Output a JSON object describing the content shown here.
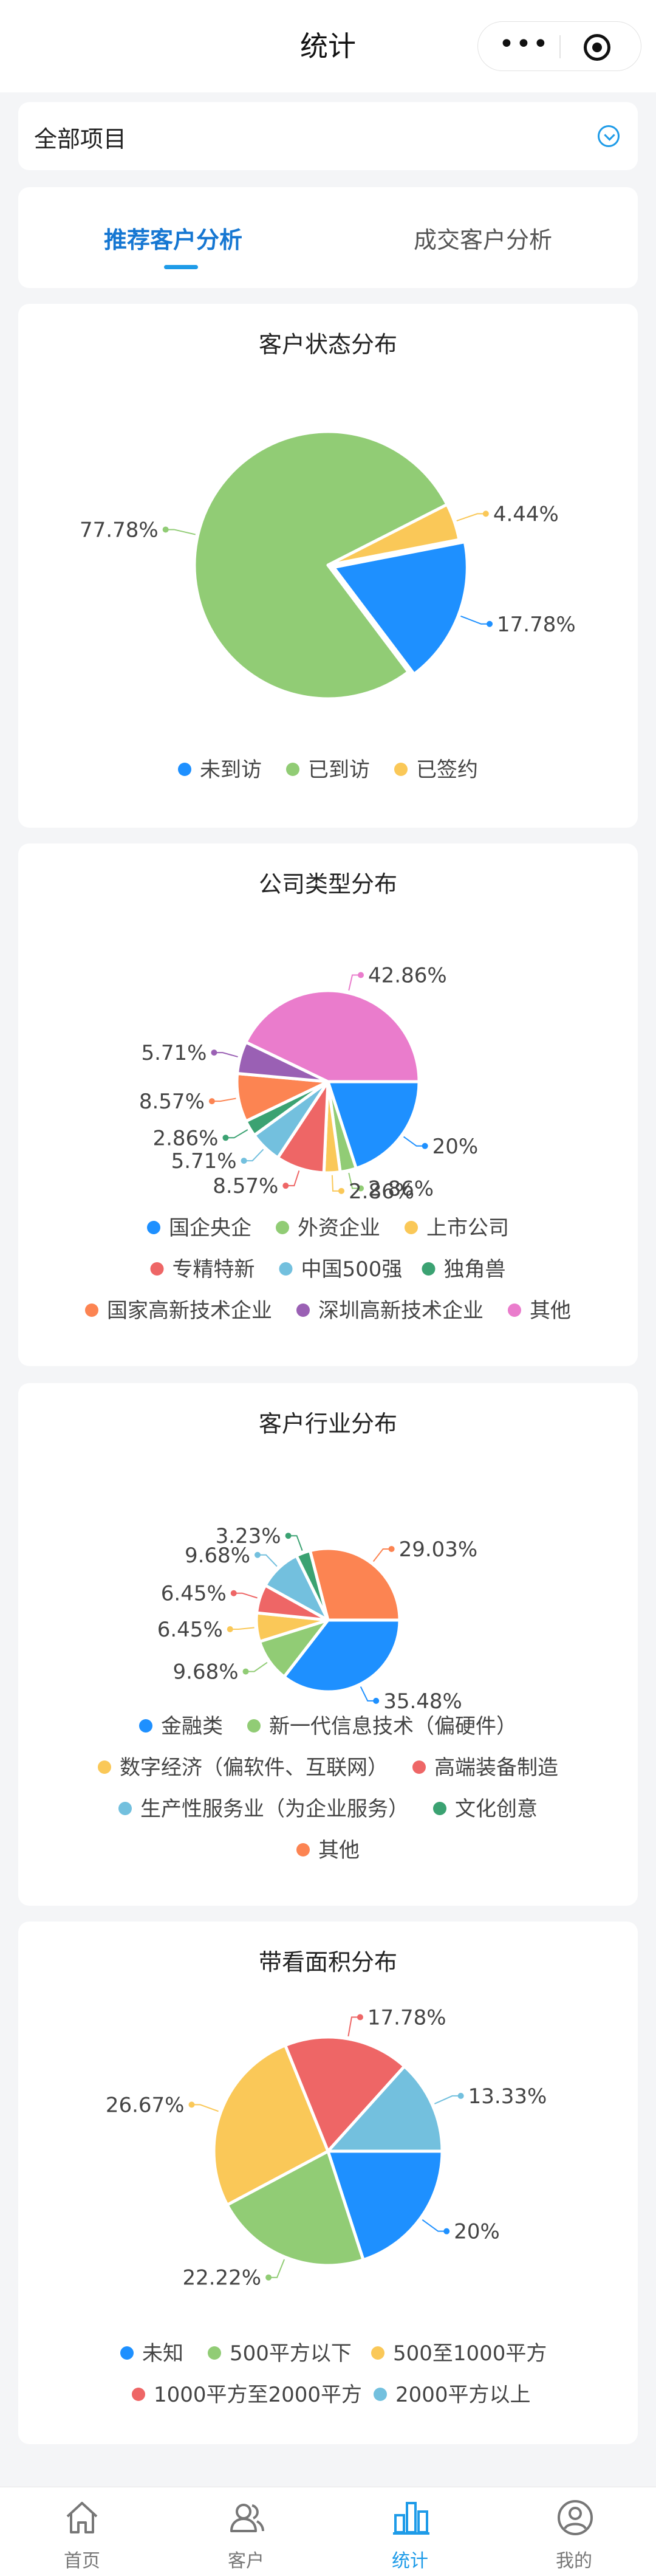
{
  "nav": {
    "title": "统计",
    "more_icon": "more-dots-icon",
    "close_icon": "target-icon"
  },
  "project_select": {
    "value": "全部项目",
    "icon": "chevron-down-circle-icon",
    "accent": "#1e9be8"
  },
  "tabs": [
    {
      "label": "推荐客户分析",
      "active": true
    },
    {
      "label": "成交客户分析",
      "active": false
    }
  ],
  "charts": [
    {
      "title": "客户状态分布",
      "chart_data": {
        "type": "pie",
        "slices": [
          {
            "name": "未到访",
            "value": 17.78,
            "label": "17.78%",
            "color": "#1e90ff"
          },
          {
            "name": "已到访",
            "value": 77.78,
            "label": "77.78%",
            "color": "#91cc75"
          },
          {
            "name": "已签约",
            "value": 4.44,
            "label": "4.44%",
            "color": "#fac858"
          }
        ],
        "legend_placement": "bottom"
      }
    },
    {
      "title": "公司类型分布",
      "chart_data": {
        "type": "pie",
        "slices": [
          {
            "name": "国企央企",
            "value": 20,
            "label": "20%",
            "color": "#1e90ff"
          },
          {
            "name": "外资企业",
            "value": 2.86,
            "label": "2.86%",
            "color": "#91cc75"
          },
          {
            "name": "上市公司",
            "value": 2.86,
            "label": "2.86%",
            "color": "#fac858"
          },
          {
            "name": "专精特新",
            "value": 8.57,
            "label": "8.57%",
            "color": "#ee6666"
          },
          {
            "name": "中国500强",
            "value": 5.71,
            "label": "5.71%",
            "color": "#73c0de"
          },
          {
            "name": "独角兽",
            "value": 2.86,
            "label": "2.86%",
            "color": "#3ba272"
          },
          {
            "name": "国家高新技术企业",
            "value": 8.57,
            "label": "8.57%",
            "color": "#fc8452"
          },
          {
            "name": "深圳高新技术企业",
            "value": 5.71,
            "label": "5.71%",
            "color": "#9a60b4"
          },
          {
            "name": "其他",
            "value": 42.86,
            "label": "42.86%",
            "color": "#ea7ccc"
          }
        ],
        "legend_placement": "bottom"
      }
    },
    {
      "title": "客户行业分布",
      "chart_data": {
        "type": "pie",
        "slices": [
          {
            "name": "金融类",
            "value": 35.48,
            "label": "35.48%",
            "color": "#1e90ff"
          },
          {
            "name": "新一代信息技术（偏硬件）",
            "value": 9.68,
            "label": "9.68%",
            "color": "#91cc75"
          },
          {
            "name": "数字经济（偏软件、互联网）",
            "value": 6.45,
            "label": "6.45%",
            "color": "#fac858"
          },
          {
            "name": "高端装备制造",
            "value": 6.45,
            "label": "6.45%",
            "color": "#ee6666"
          },
          {
            "name": "生产性服务业（为企业服务）",
            "value": 9.68,
            "label": "9.68%",
            "color": "#73c0de"
          },
          {
            "name": "文化创意",
            "value": 3.23,
            "label": "3.23%",
            "color": "#3ba272"
          },
          {
            "name": "其他",
            "value": 29.03,
            "label": "29.03%",
            "color": "#fc8452"
          }
        ],
        "legend_placement": "bottom"
      }
    },
    {
      "title": "带看面积分布",
      "chart_data": {
        "type": "pie",
        "slices": [
          {
            "name": "未知",
            "value": 20,
            "label": "20%",
            "color": "#1e90ff"
          },
          {
            "name": "500平方以下",
            "value": 22.22,
            "label": "22.22%",
            "color": "#91cc75"
          },
          {
            "name": "500至1000平方",
            "value": 26.67,
            "label": "26.67%",
            "color": "#fac858"
          },
          {
            "name": "1000平方至2000平方",
            "value": 17.78,
            "label": "17.78%",
            "color": "#ee6666"
          },
          {
            "name": "2000平方以上",
            "value": 13.33,
            "label": "13.33%",
            "color": "#73c0de"
          }
        ],
        "legend_placement": "bottom"
      }
    }
  ],
  "tab_bar": [
    {
      "label": "首页",
      "icon": "home-icon",
      "active": false
    },
    {
      "label": "客户",
      "icon": "customers-icon",
      "active": false
    },
    {
      "label": "统计",
      "icon": "stats-icon",
      "active": true
    },
    {
      "label": "我的",
      "icon": "profile-icon",
      "active": false
    }
  ]
}
